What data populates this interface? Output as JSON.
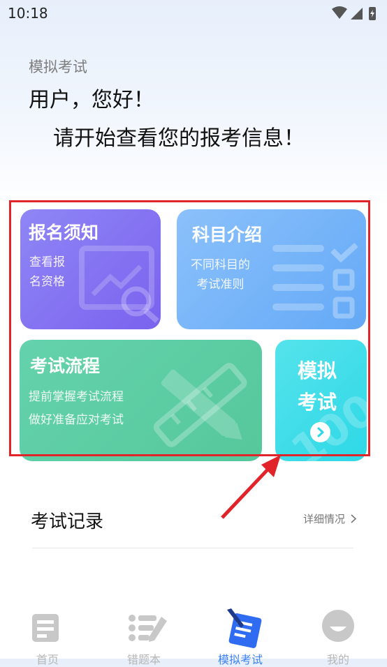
{
  "status_bar": {
    "time": "10:18"
  },
  "header": {
    "page_label": "模拟考试",
    "greeting": "用户，您好！",
    "intro": "请开始查看您的报考信息！"
  },
  "cards": {
    "notice": {
      "title": "报名须知",
      "desc": "查看报\n名资格",
      "color": "#7f6ff0"
    },
    "subject": {
      "title": "科目介绍",
      "desc": "不同科目的\n考试准则",
      "color": "#75b3f8"
    },
    "process": {
      "title": "考试流程",
      "desc": "提前掌握考试流程\n做好准备应对考试",
      "color": "#5ccda4"
    },
    "mock": {
      "title": "模拟\n考试",
      "color": "#3ddce8",
      "deco_text": "100"
    }
  },
  "records": {
    "title": "考试记录",
    "link": "详细情况"
  },
  "tabbar": {
    "items": [
      {
        "label": "首页",
        "icon": "home-doc-icon"
      },
      {
        "label": "错题本",
        "icon": "error-list-icon"
      },
      {
        "label": "模拟考试",
        "icon": "mock-exam-icon",
        "active": true
      },
      {
        "label": "我的",
        "icon": "profile-icon"
      }
    ],
    "active_color": "#3b82f6",
    "inactive_color": "#c8c8c8"
  },
  "annotation": {
    "highlight_color": "#e0242a"
  }
}
